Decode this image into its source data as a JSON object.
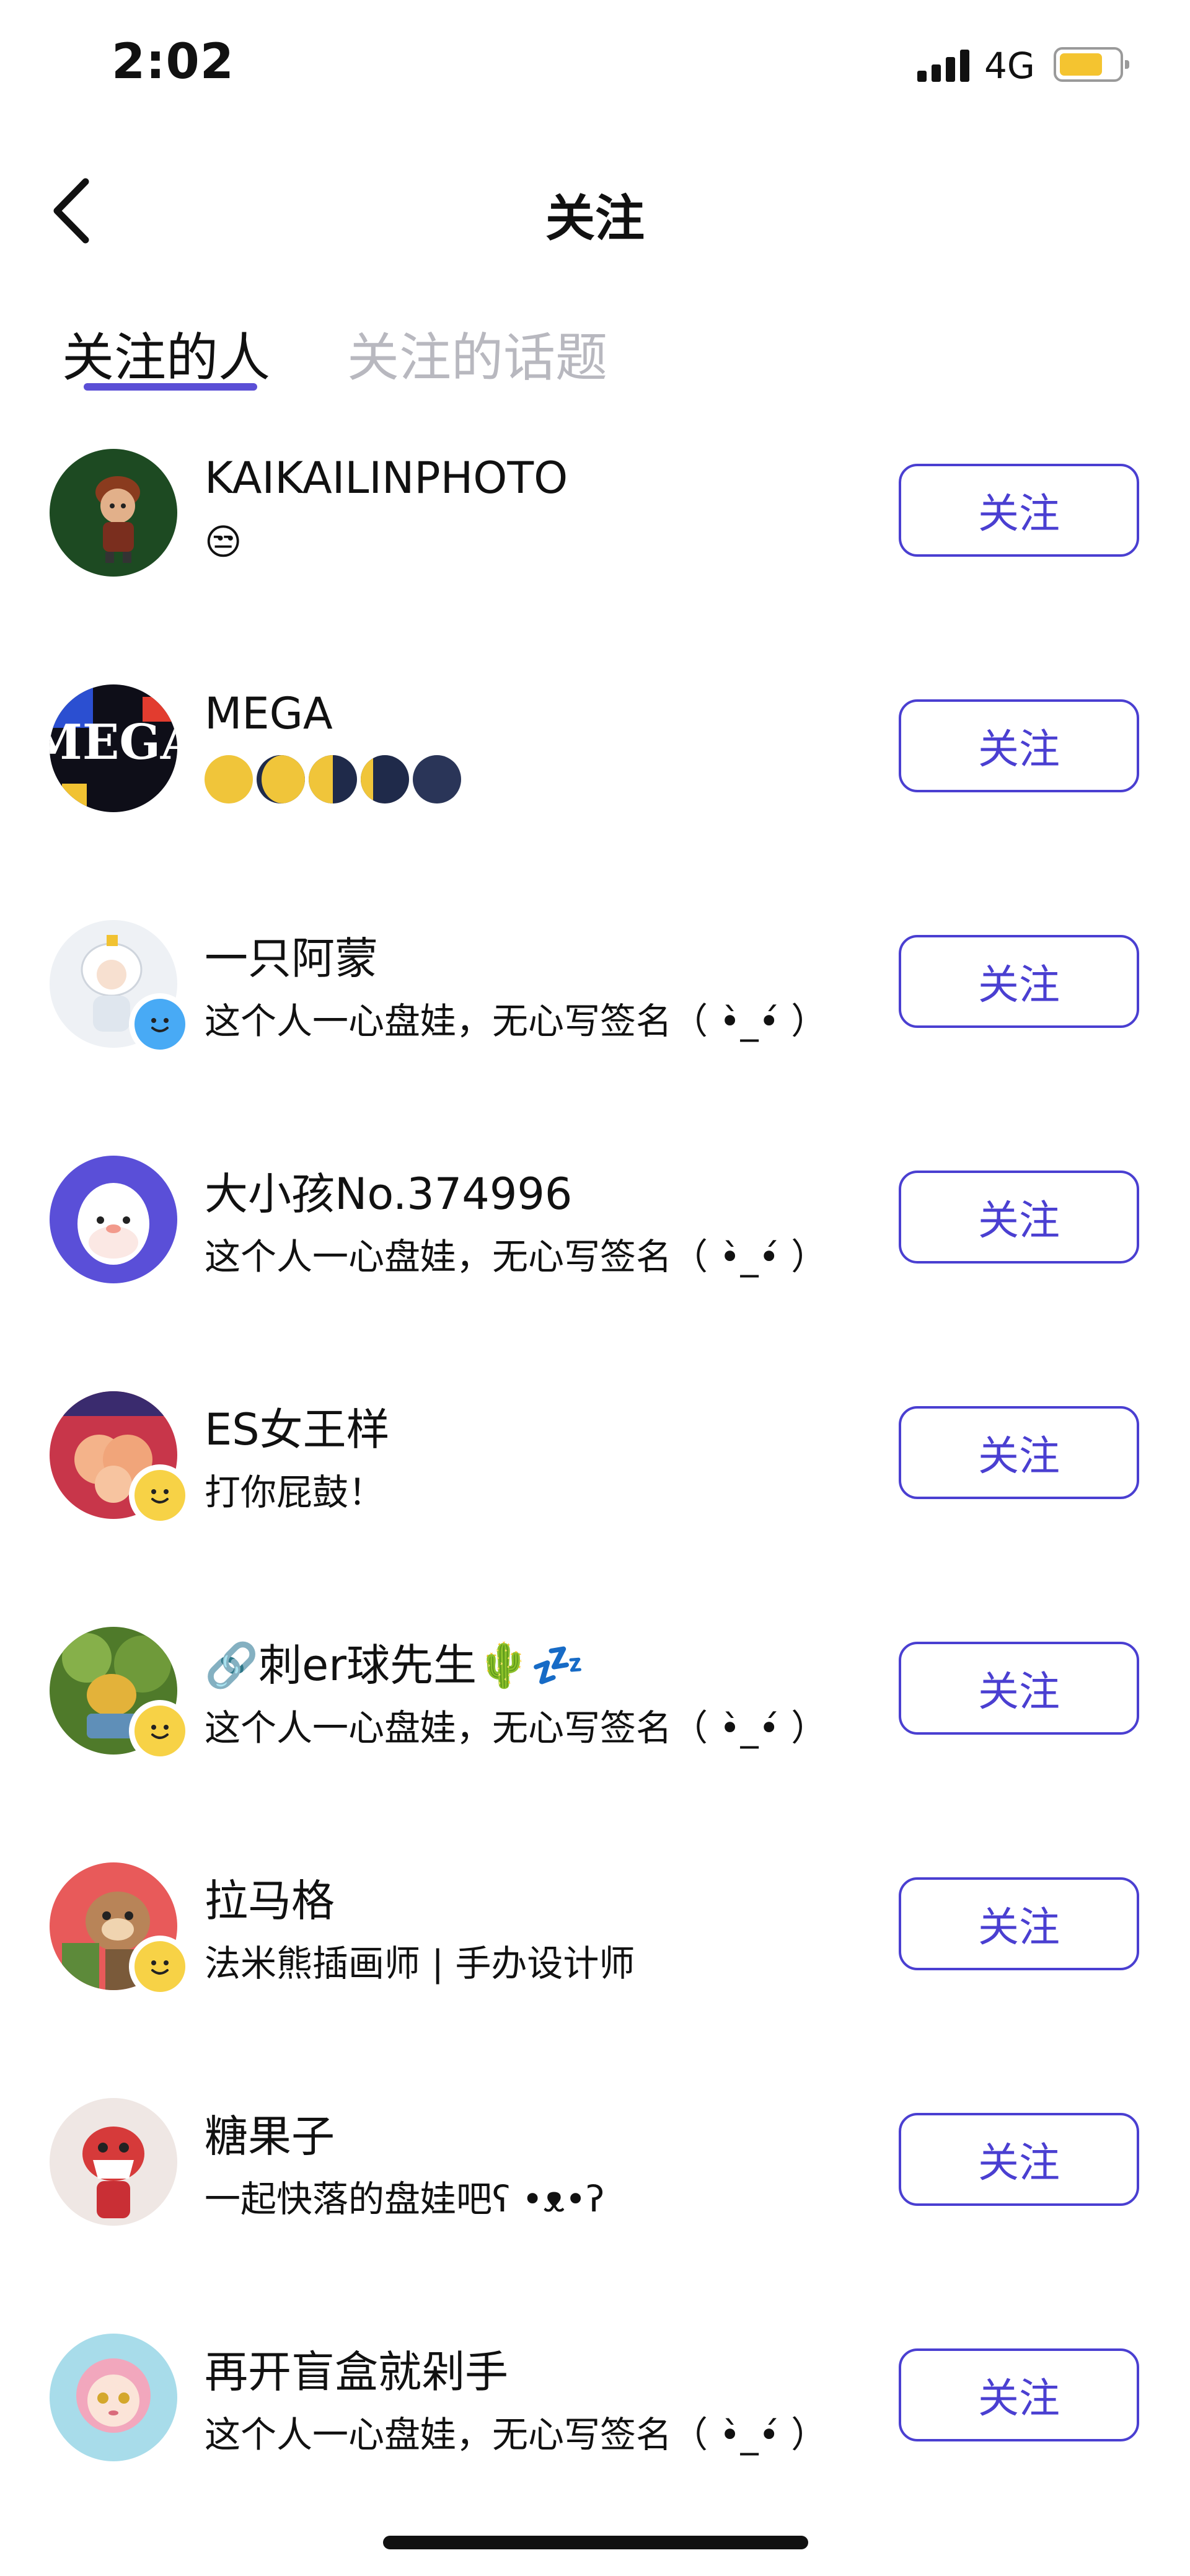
{
  "status_bar": {
    "time": "2:02",
    "network": "4G"
  },
  "nav": {
    "title": "关注"
  },
  "tabs": [
    {
      "label": "关注的人",
      "active": true
    },
    {
      "label": "关注的话题",
      "active": false
    }
  ],
  "follow_label": "关注",
  "users": [
    {
      "name": "KAIKAILINPHOTO",
      "signature": "😒"
    },
    {
      "name": "MEGA",
      "signature": ""
    },
    {
      "name": "一只阿蒙",
      "signature": "这个人一心盘娃，无心写签名（ •̀_•́ ）"
    },
    {
      "name": "大小孩No.374996",
      "signature": "这个人一心盘娃，无心写签名（ •̀_•́ ）"
    },
    {
      "name": "ES女王样",
      "signature": "打你屁鼓！"
    },
    {
      "name": "🔗刺er球先生🌵💤",
      "signature": "这个人一心盘娃，无心写签名（ •̀_•́ ）"
    },
    {
      "name": "拉马格",
      "signature": "法米熊插画师 | 手办设计师"
    },
    {
      "name": "糖果子",
      "signature": "一起快落的盘娃吧ʕ •ᴥ•ʔ"
    },
    {
      "name": "再开盲盒就剁手",
      "signature": "这个人一心盘娃，无心写签名（ •̀_•́ ）"
    }
  ],
  "mega_avatar_text": "MEGA",
  "colors": {
    "accent": "#4a3fd1",
    "tab_indicator": "#5b4fd6",
    "badge_yellow": "#f7d246",
    "badge_blue": "#48aaf5"
  }
}
